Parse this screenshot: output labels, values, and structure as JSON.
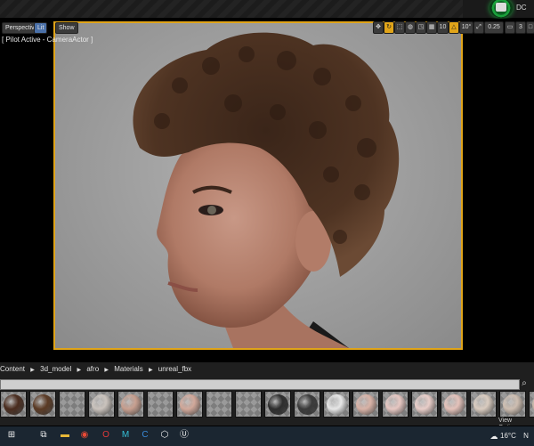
{
  "topbar": {
    "user_tag": "DC"
  },
  "viewport": {
    "perspective_label": "Perspective",
    "lit_label": "Lit",
    "show_label": "Show",
    "pilot_label": "[ Pilot Active - CameraActor ]",
    "toolbar": {
      "grid_value": "10",
      "angle_value": "10°",
      "scale_value": "0.25",
      "camera_speed": "3"
    }
  },
  "content_browser": {
    "breadcrumbs": [
      "Content",
      "3d_model",
      "afro",
      "Materials",
      "unreal_fbx"
    ],
    "separator": "▶",
    "view_options_label": "View Options ▾",
    "thumbnails": [
      {
        "name": "thumb-brown-sphere",
        "color": "#4a2c1e"
      },
      {
        "name": "thumb-hair-sphere",
        "color": "#5b3a24"
      },
      {
        "name": "thumb-empty",
        "color": ""
      },
      {
        "name": "thumb-white-sphere-dark",
        "color": "#c9c2bc"
      },
      {
        "name": "thumb-skin-sphere",
        "color": "#c79f8f"
      },
      {
        "name": "thumb-empty",
        "color": ""
      },
      {
        "name": "thumb-skin-sphere-2",
        "color": "#d1a89a"
      },
      {
        "name": "thumb-empty",
        "color": ""
      },
      {
        "name": "thumb-empty",
        "color": ""
      },
      {
        "name": "thumb-dark-sphere",
        "color": "#2d2d2d"
      },
      {
        "name": "thumb-dark-sphere-2",
        "color": "#3a3a3a"
      },
      {
        "name": "thumb-white-sphere",
        "color": "#e6e6e6"
      },
      {
        "name": "thumb-skin-sphere-3",
        "color": "#d8b2a6"
      },
      {
        "name": "thumb-pink-sphere",
        "color": "#e6c7c2"
      },
      {
        "name": "thumb-pink-sphere-2",
        "color": "#e8cdc8"
      },
      {
        "name": "thumb-pink-sphere-3",
        "color": "#e3c1b9"
      },
      {
        "name": "thumb-beige-sphere",
        "color": "#d9cbbf"
      },
      {
        "name": "thumb-beige-sphere-2",
        "color": "#cdbdb0"
      },
      {
        "name": "thumb-beige-sphere-3",
        "color": "#c9b7a8"
      }
    ]
  },
  "taskbar": {
    "temperature": "16°C",
    "extra": "N"
  },
  "colors": {
    "accent": "#e0a419",
    "viewport_bg": "#a0a0a0",
    "taskbar": "#1b2631"
  }
}
